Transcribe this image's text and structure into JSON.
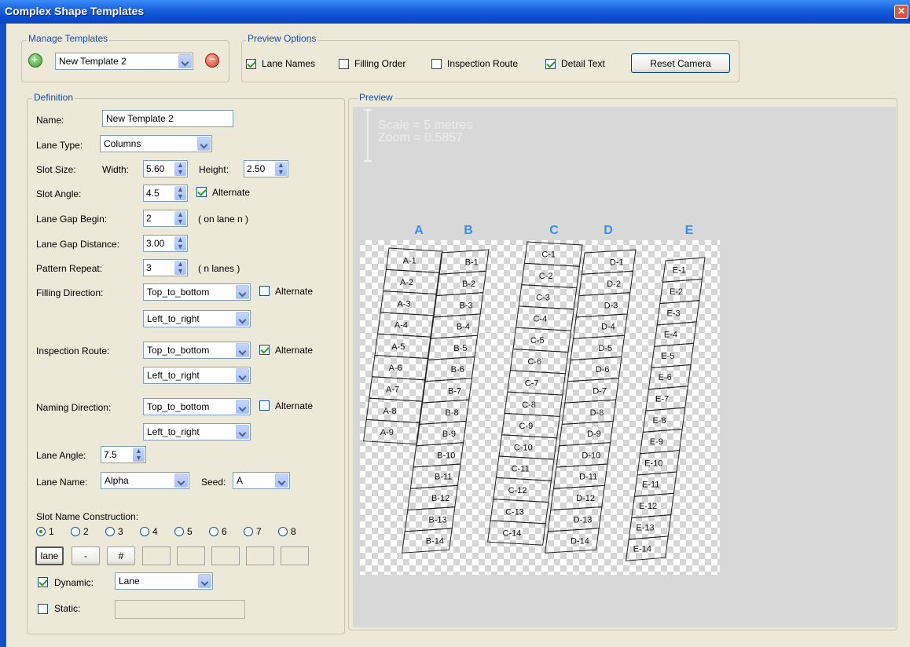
{
  "window": {
    "title": "Complex Shape Templates"
  },
  "manage": {
    "legend": "Manage Templates",
    "selected_template": "New Template 2",
    "add_icon": "add-icon",
    "remove_icon": "remove-icon"
  },
  "preview_options": {
    "legend": "Preview Options",
    "lane_names": {
      "label": "Lane Names",
      "checked": true
    },
    "filling_order": {
      "label": "Filling Order",
      "checked": false
    },
    "inspection_route": {
      "label": "Inspection Route",
      "checked": false
    },
    "detail_text": {
      "label": "Detail Text",
      "checked": true
    },
    "reset_camera": "Reset Camera"
  },
  "definition": {
    "legend": "Definition",
    "name_label": "Name:",
    "name_value": "New Template 2",
    "lane_type_label": "Lane Type:",
    "lane_type_value": "Columns",
    "slot_size_label": "Slot Size:",
    "width_label": "Width:",
    "width_value": "5.60",
    "height_label": "Height:",
    "height_value": "2.50",
    "slot_angle_label": "Slot Angle:",
    "slot_angle_value": "4.5",
    "slot_angle_alternate": "Alternate",
    "lane_gap_begin_label": "Lane Gap Begin:",
    "lane_gap_begin_value": "2",
    "lane_gap_begin_hint": "( on lane n )",
    "lane_gap_distance_label": "Lane Gap Distance:",
    "lane_gap_distance_value": "3.00",
    "pattern_repeat_label": "Pattern Repeat:",
    "pattern_repeat_value": "3",
    "pattern_repeat_hint": "( n lanes )",
    "filling_direction_label": "Filling Direction:",
    "filling_direction_1": "Top_to_bottom",
    "filling_direction_2": "Left_to_right",
    "filling_alternate": "Alternate",
    "inspection_route_label": "Inspection Route:",
    "inspection_route_1": "Top_to_bottom",
    "inspection_route_2": "Left_to_right",
    "inspection_alternate": "Alternate",
    "naming_direction_label": "Naming Direction:",
    "naming_direction_1": "Top_to_bottom",
    "naming_direction_2": "Left_to_right",
    "naming_alternate": "Alternate",
    "lane_angle_label": "Lane Angle:",
    "lane_angle_value": "7.5",
    "lane_name_label": "Lane Name:",
    "lane_name_value": "Alpha",
    "seed_label": "Seed:",
    "seed_value": "A",
    "slot_name_construction_label": "Slot Name Construction:",
    "radio_options": [
      "1",
      "2",
      "3",
      "4",
      "5",
      "6",
      "7",
      "8"
    ],
    "radio_selected": "1",
    "construction_boxes": [
      "lane",
      "-",
      "#",
      "",
      "",
      "",
      "",
      ""
    ],
    "dynamic_label": "Dynamic:",
    "dynamic_value": "Lane",
    "static_label": "Static:"
  },
  "preview": {
    "legend": "Preview",
    "scale_text": "Scale = 5 metres",
    "zoom_text": "Zoom = 0.5857",
    "lanes": [
      {
        "name": "A",
        "slots": [
          "A-1",
          "A-2",
          "A-3",
          "A-4",
          "A-5",
          "A-6",
          "A-7",
          "A-8",
          "A-9"
        ]
      },
      {
        "name": "B",
        "slots": [
          "B-1",
          "B-2",
          "B-3",
          "B-4",
          "B-5",
          "B-6",
          "B-7",
          "B-8",
          "B-9",
          "B-10",
          "B-11",
          "B-12",
          "B-13",
          "B-14"
        ]
      },
      {
        "name": "C",
        "slots": [
          "C-1",
          "C-2",
          "C-3",
          "C-4",
          "C-5",
          "C-6",
          "C-7",
          "C-8",
          "C-9",
          "C-10",
          "C-11",
          "C-12",
          "C-13",
          "C-14"
        ]
      },
      {
        "name": "D",
        "slots": [
          "D-1",
          "D-2",
          "D-3",
          "D-4",
          "D-5",
          "D-6",
          "D-7",
          "D-8",
          "D-9",
          "D-10",
          "D-11",
          "D-12",
          "D-13",
          "D-14"
        ]
      },
      {
        "name": "E",
        "slots": [
          "E-1",
          "E-2",
          "E-3",
          "E-4",
          "E-5",
          "E-6",
          "E-7",
          "E-8",
          "E-9",
          "E-10",
          "E-11",
          "E-12",
          "E-13",
          "E-14"
        ]
      }
    ]
  },
  "colors": {
    "lane_name": "#3a8ef0",
    "titlebar": "#0a4fd0"
  }
}
